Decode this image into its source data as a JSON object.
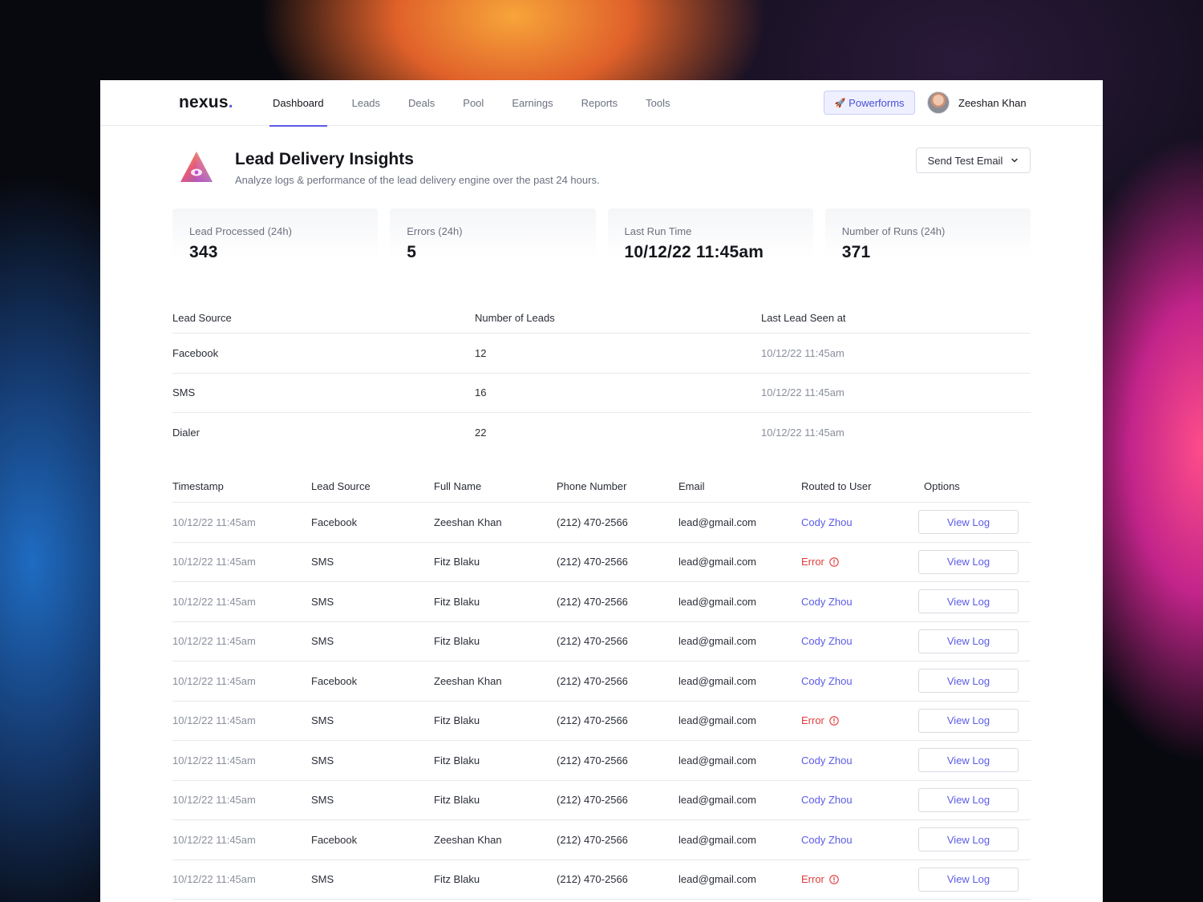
{
  "app": {
    "logo": "nexus",
    "logo_dot": "."
  },
  "nav": {
    "items": [
      {
        "label": "Dashboard",
        "active": true
      },
      {
        "label": "Leads",
        "active": false
      },
      {
        "label": "Deals",
        "active": false
      },
      {
        "label": "Pool",
        "active": false
      },
      {
        "label": "Earnings",
        "active": false
      },
      {
        "label": "Reports",
        "active": false
      },
      {
        "label": "Tools",
        "active": false
      }
    ],
    "powerforms_label": "Powerforms",
    "powerforms_icon": "rocket-icon",
    "user_name": "Zeeshan Khan"
  },
  "header": {
    "title": "Lead Delivery Insights",
    "subtitle": "Analyze logs & performance of the lead delivery engine over the past 24 hours.",
    "send_test_label": "Send Test Email"
  },
  "stats": [
    {
      "label": "Lead Processed (24h)",
      "value": "343"
    },
    {
      "label": "Errors (24h)",
      "value": "5"
    },
    {
      "label": "Last Run Time",
      "value": "10/12/22 11:45am"
    },
    {
      "label": "Number of Runs (24h)",
      "value": "371"
    }
  ],
  "sources": {
    "columns": [
      "Lead Source",
      "Number of Leads",
      "Last Lead Seen at"
    ],
    "rows": [
      [
        "Facebook",
        "12",
        "10/12/22 11:45am"
      ],
      [
        "SMS",
        "16",
        "10/12/22 11:45am"
      ],
      [
        "Dialer",
        "22",
        "10/12/22 11:45am"
      ]
    ]
  },
  "logs": {
    "columns": [
      "Timestamp",
      "Lead Source",
      "Full Name",
      "Phone Number",
      "Email",
      "Routed to User",
      "Options"
    ],
    "view_log_label": "View Log",
    "rows": [
      {
        "timestamp": "10/12/22 11:45am",
        "source": "Facebook",
        "name": "Zeeshan Khan",
        "phone": "(212) 470-2566",
        "email": "lead@gmail.com",
        "routed": "Cody Zhou",
        "error": false
      },
      {
        "timestamp": "10/12/22 11:45am",
        "source": "SMS",
        "name": "Fitz Blaku",
        "phone": "(212) 470-2566",
        "email": "lead@gmail.com",
        "routed": "Error",
        "error": true
      },
      {
        "timestamp": "10/12/22 11:45am",
        "source": "SMS",
        "name": "Fitz Blaku",
        "phone": "(212) 470-2566",
        "email": "lead@gmail.com",
        "routed": "Cody Zhou",
        "error": false
      },
      {
        "timestamp": "10/12/22 11:45am",
        "source": "SMS",
        "name": "Fitz Blaku",
        "phone": "(212) 470-2566",
        "email": "lead@gmail.com",
        "routed": "Cody Zhou",
        "error": false
      },
      {
        "timestamp": "10/12/22 11:45am",
        "source": "Facebook",
        "name": "Zeeshan Khan",
        "phone": "(212) 470-2566",
        "email": "lead@gmail.com",
        "routed": "Cody Zhou",
        "error": false
      },
      {
        "timestamp": "10/12/22 11:45am",
        "source": "SMS",
        "name": "Fitz Blaku",
        "phone": "(212) 470-2566",
        "email": "lead@gmail.com",
        "routed": "Error",
        "error": true
      },
      {
        "timestamp": "10/12/22 11:45am",
        "source": "SMS",
        "name": "Fitz Blaku",
        "phone": "(212) 470-2566",
        "email": "lead@gmail.com",
        "routed": "Cody Zhou",
        "error": false
      },
      {
        "timestamp": "10/12/22 11:45am",
        "source": "SMS",
        "name": "Fitz Blaku",
        "phone": "(212) 470-2566",
        "email": "lead@gmail.com",
        "routed": "Cody Zhou",
        "error": false
      },
      {
        "timestamp": "10/12/22 11:45am",
        "source": "Facebook",
        "name": "Zeeshan Khan",
        "phone": "(212) 470-2566",
        "email": "lead@gmail.com",
        "routed": "Cody Zhou",
        "error": false
      },
      {
        "timestamp": "10/12/22 11:45am",
        "source": "SMS",
        "name": "Fitz Blaku",
        "phone": "(212) 470-2566",
        "email": "lead@gmail.com",
        "routed": "Error",
        "error": true
      }
    ]
  },
  "colors": {
    "accent": "#5b5ce6",
    "error": "#e23b3b",
    "border": "#e6e8ee"
  }
}
